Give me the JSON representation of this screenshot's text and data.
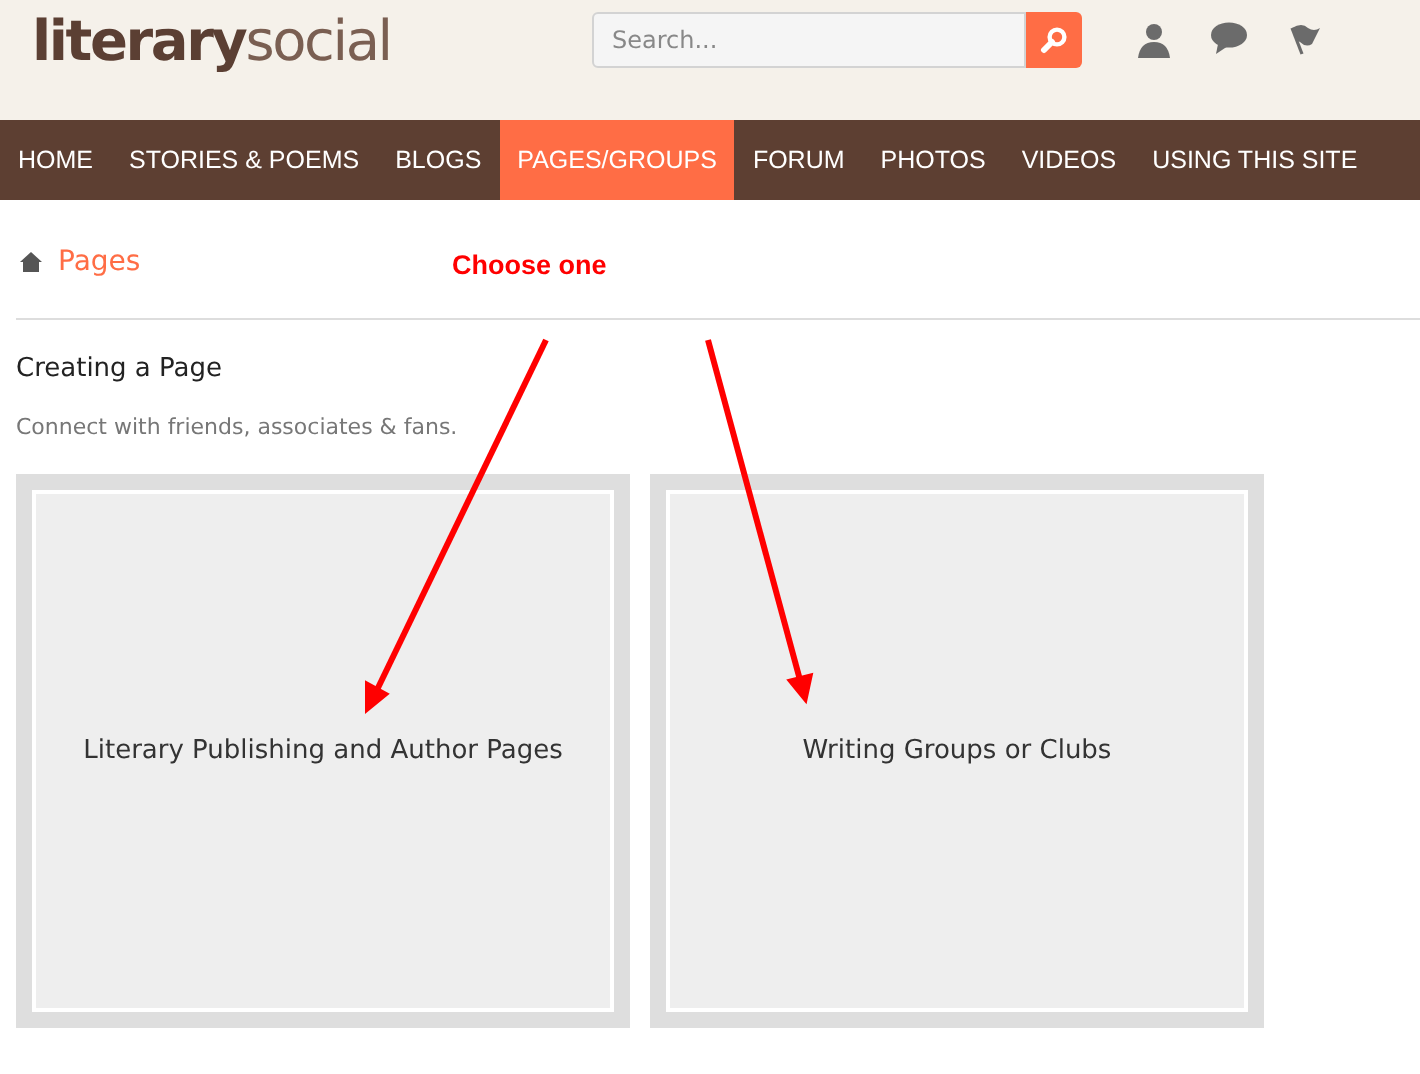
{
  "logo": {
    "bold": "literary",
    "light": "social"
  },
  "search": {
    "placeholder": "Search..."
  },
  "nav": [
    {
      "label": "HOME",
      "selected": false
    },
    {
      "label": "STORIES & POEMS",
      "selected": false
    },
    {
      "label": "BLOGS",
      "selected": false
    },
    {
      "label": "PAGES/GROUPS",
      "selected": true
    },
    {
      "label": "FORUM",
      "selected": false
    },
    {
      "label": "PHOTOS",
      "selected": false
    },
    {
      "label": "VIDEOS",
      "selected": false
    },
    {
      "label": "USING THIS SITE",
      "selected": false
    }
  ],
  "breadcrumb": "Pages",
  "annotation": "Choose one",
  "heading": "Creating a Page",
  "subtitle": "Connect with friends, associates & fans.",
  "cards": [
    {
      "label": "Literary Publishing and Author Pages"
    },
    {
      "label": "Writing Groups or Clubs"
    }
  ]
}
